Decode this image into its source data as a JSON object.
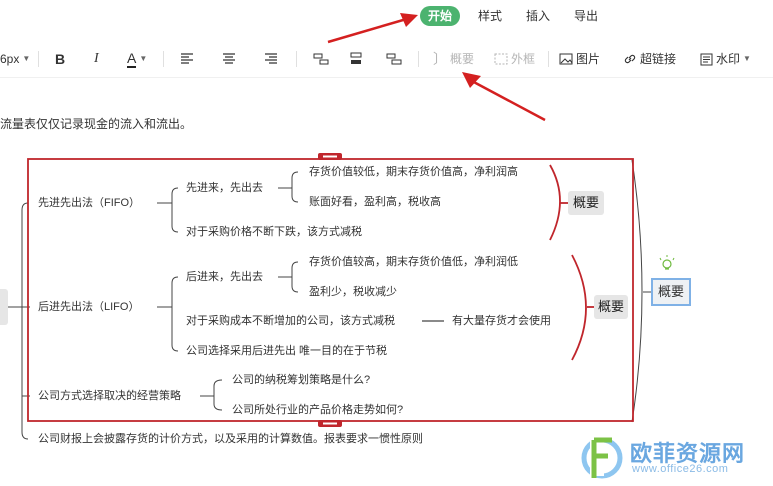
{
  "menu": {
    "tabs": [
      {
        "label": "开始",
        "active": true
      },
      {
        "label": "样式",
        "active": false
      },
      {
        "label": "插入",
        "active": false
      },
      {
        "label": "导出",
        "active": false
      }
    ]
  },
  "toolbar": {
    "font_size": "6px",
    "bold": "B",
    "italic": "I",
    "font_color": "A",
    "summary": "概要",
    "frame": "外框",
    "image": "图片",
    "hyperlink": "超链接",
    "watermark": "水印"
  },
  "canvas": {
    "note": "流量表仅仅记录现金的流入和流出。",
    "nodes": {
      "fifo": "先进先出法（FIFO）",
      "fifo_a": "先进来，先出去",
      "fifo_a1": "存货价值较低，期末存货价值高，净利润高",
      "fifo_a2": "账面好看，盈利高，税收高",
      "fifo_b": "对于采购价格不断下跌，该方式减税",
      "lifo": "后进先出法（LIFO）",
      "lifo_a": "后进来，先出去",
      "lifo_a1": "存货价值较高，期末存货价值低，净利润低",
      "lifo_a2": "盈利少，税收减少",
      "lifo_b": "对于采购成本不断增加的公司，该方式减税",
      "lifo_b1": "有大量存货才会使用",
      "lifo_c": "公司选择采用后进先出 唯一目的在于节税",
      "strategy": "公司方式选择取决的经营策略",
      "strategy_a": "公司的纳税筹划策略是什么?",
      "strategy_b": "公司所处行业的产品价格走势如何?",
      "report": "公司财报上会披露存货的计价方式，以及采用的计算数值。报表要求一惯性原则"
    },
    "summaries": {
      "s1": "概要",
      "s2": "概要",
      "outer": "概要"
    }
  },
  "watermark": {
    "text": "欧菲资源网",
    "url": "www.office26.com"
  },
  "colors": {
    "accent_green": "#4cb36f",
    "selection_red": "#c0262c",
    "arrow_red": "#d42020",
    "watermark_blue": "#6aa7e0"
  }
}
